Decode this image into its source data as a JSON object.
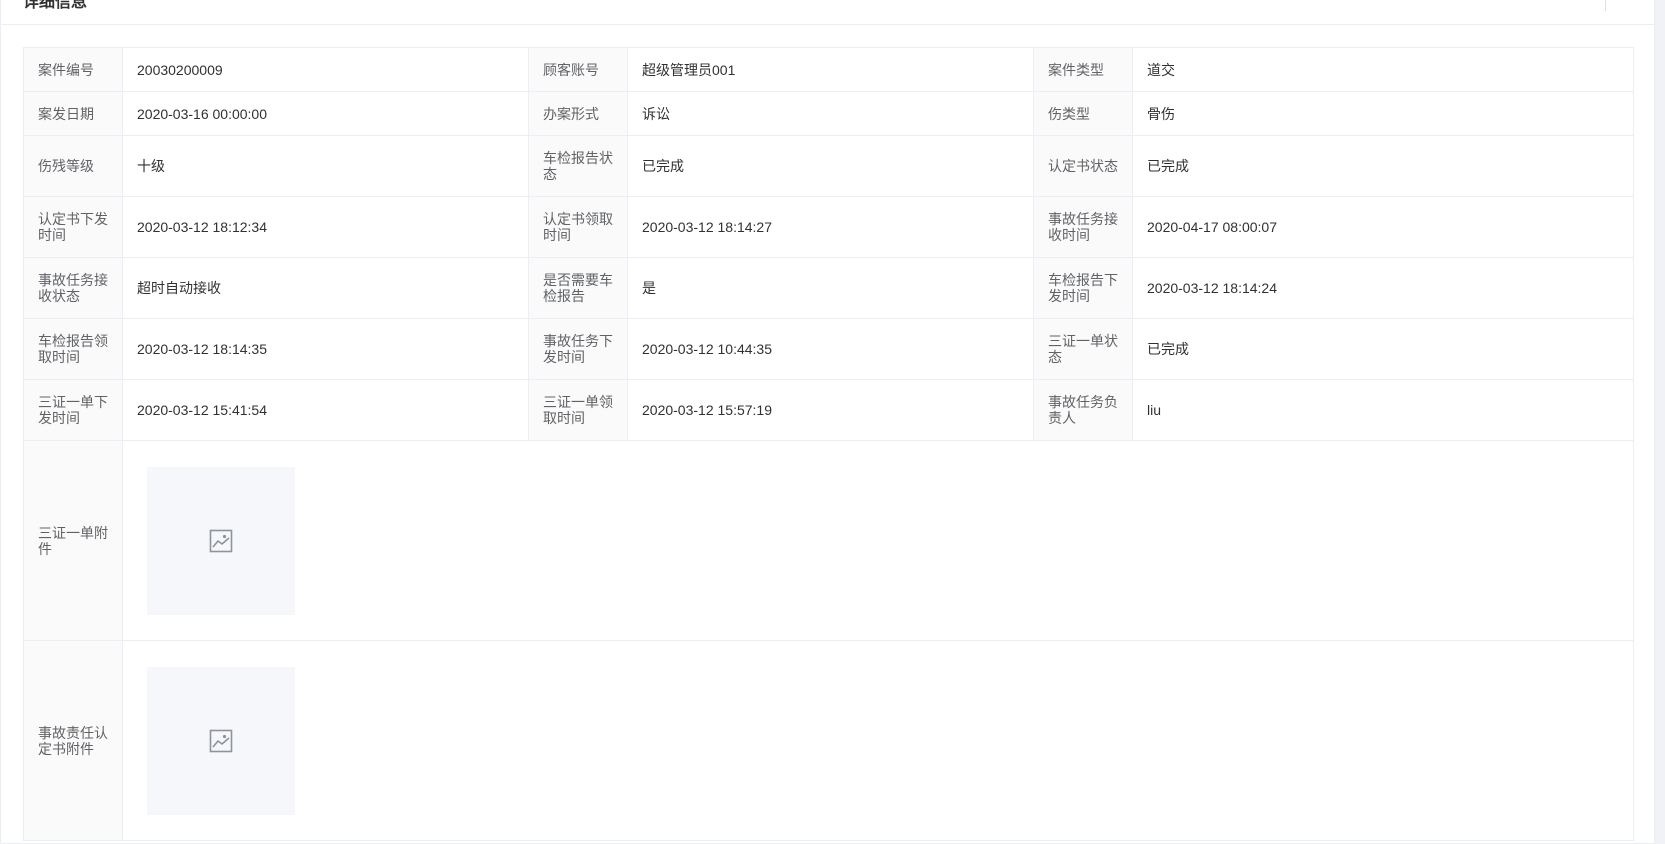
{
  "card": {
    "title": "详细信息",
    "toggle_icon": "chevron-up-icon"
  },
  "rows": [
    [
      {
        "label": "案件编号",
        "value": "20030200009"
      },
      {
        "label": "顾客账号",
        "value": "超级管理员001"
      },
      {
        "label": "案件类型",
        "value": "道交"
      }
    ],
    [
      {
        "label": "案发日期",
        "value": "2020-03-16 00:00:00"
      },
      {
        "label": "办案形式",
        "value": "诉讼"
      },
      {
        "label": "伤类型",
        "value": "骨伤"
      }
    ],
    [
      {
        "label": "伤残等级",
        "value": "十级"
      },
      {
        "label": "车检报告状态",
        "value": "已完成"
      },
      {
        "label": "认定书状态",
        "value": "已完成"
      }
    ],
    [
      {
        "label": "认定书下发时间",
        "value": "2020-03-12 18:12:34"
      },
      {
        "label": "认定书领取时间",
        "value": "2020-03-12 18:14:27"
      },
      {
        "label": "事故任务接收时间",
        "value": "2020-04-17 08:00:07"
      }
    ],
    [
      {
        "label": "事故任务接收状态",
        "value": "超时自动接收"
      },
      {
        "label": "是否需要车检报告",
        "value": "是"
      },
      {
        "label": "车检报告下发时间",
        "value": "2020-03-12 18:14:24"
      }
    ],
    [
      {
        "label": "车检报告领取时间",
        "value": "2020-03-12 18:14:35"
      },
      {
        "label": "事故任务下发时间",
        "value": "2020-03-12 10:44:35"
      },
      {
        "label": "三证一单状态",
        "value": "已完成"
      }
    ],
    [
      {
        "label": "三证一单下发时间",
        "value": "2020-03-12 15:41:54"
      },
      {
        "label": "三证一单领取时间",
        "value": "2020-03-12 15:57:19"
      },
      {
        "label": "事故任务负责人",
        "value": "liu"
      }
    ]
  ],
  "attachments": [
    {
      "label": "三证一单附件",
      "icon": "image-placeholder-icon"
    },
    {
      "label": "事故责任认定书附件",
      "icon": "image-placeholder-icon"
    }
  ],
  "colors": {
    "label_bg": "#fafafa",
    "border": "#ebeef5",
    "thumb_bg": "#f5f7fa",
    "label_text": "#606266",
    "value_text": "#303133"
  }
}
